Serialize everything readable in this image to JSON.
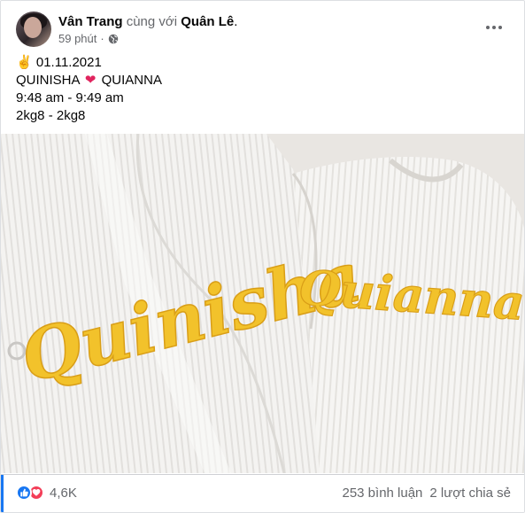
{
  "post": {
    "author": "Vân Trang",
    "with_text": "cùng với",
    "tagged": "Quân Lê",
    "period": ".",
    "time": "59 phút",
    "time_separator": "·",
    "privacy_icon": "globe-icon",
    "more_icon": "more-horizontal-icon"
  },
  "content": {
    "line1_emoji": "✌",
    "line1_text": "01.11.2021",
    "line2_a": "QUINISHA",
    "line2_heart": "❤",
    "line2_b": "QUIANNA",
    "line3": "9:48 am - 9:49 am",
    "line4": "2kg8 - 2kg8"
  },
  "photo": {
    "embroidery_left": "Quinisha",
    "embroidery_right": "Quianna"
  },
  "footer": {
    "reaction_icons": [
      "like-icon",
      "love-icon"
    ],
    "reaction_count": "4,6K",
    "comments": "253 bình luận",
    "shares": "2 lượt chia sẻ"
  },
  "colors": {
    "brand_blue": "#1877f2",
    "love_red": "#f33e58",
    "secondary_text": "#65676b",
    "embroidery_yellow": "#f2c22b"
  }
}
